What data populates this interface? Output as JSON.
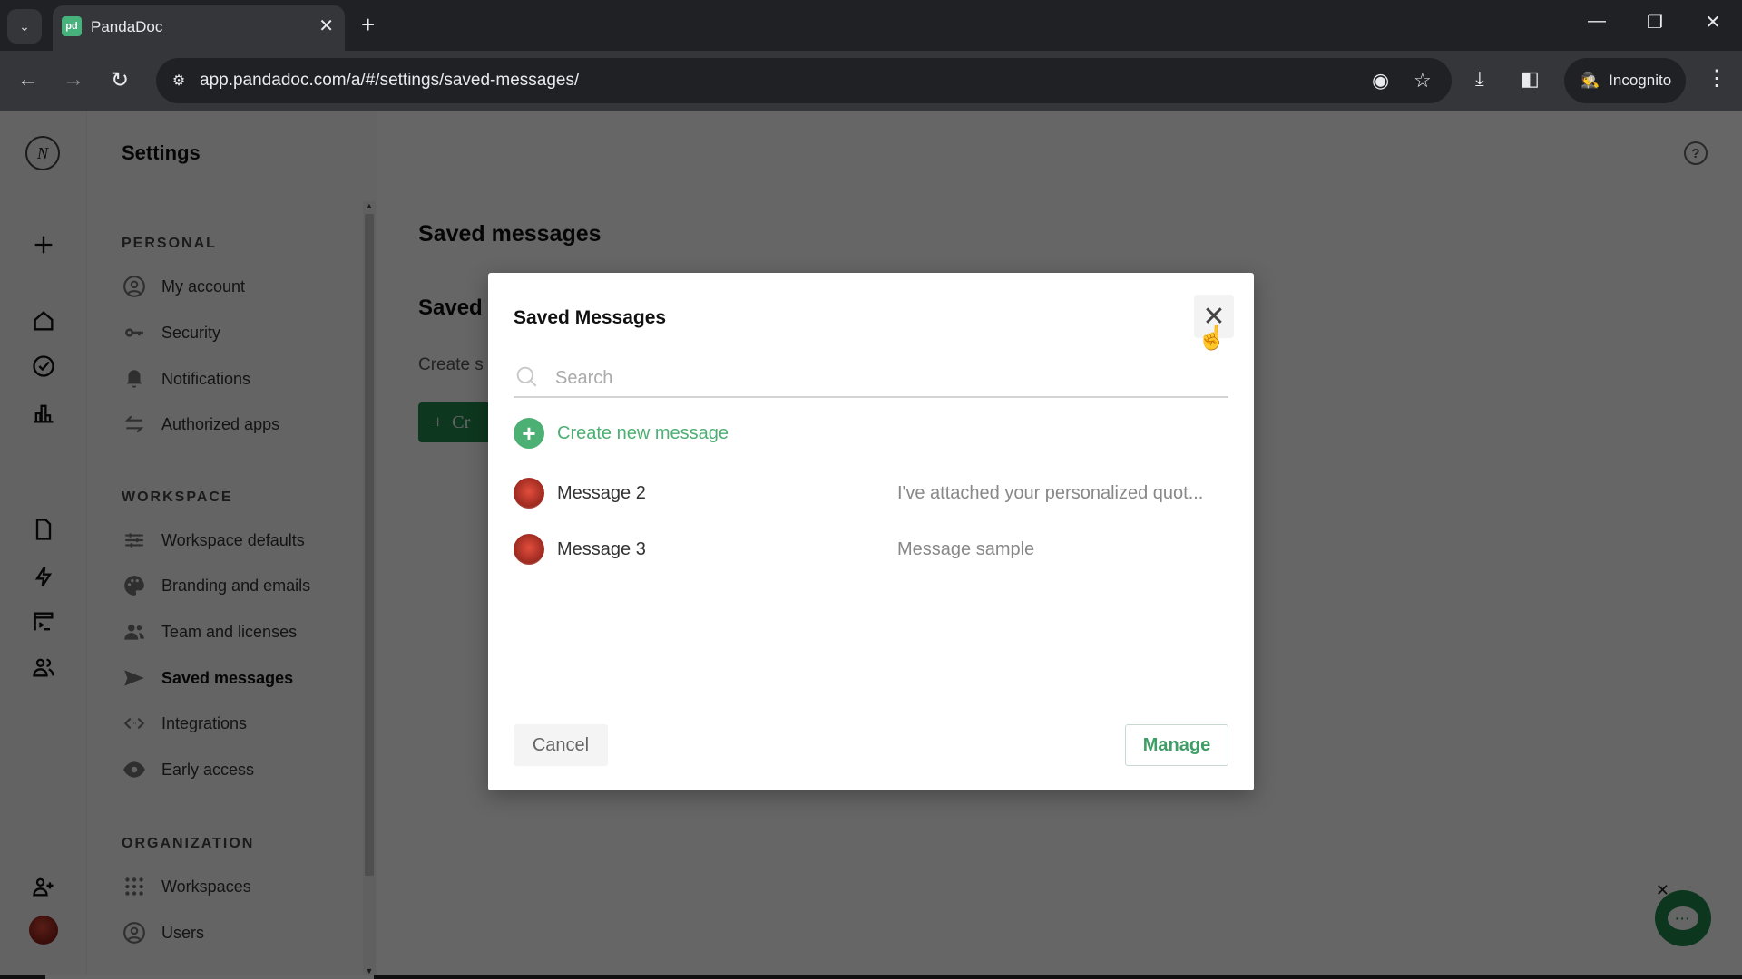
{
  "browser": {
    "tab_title": "PandaDoc",
    "favicon_text": "pd",
    "url": "app.pandadoc.com/a/#/settings/saved-messages/",
    "profile_label": "Incognito"
  },
  "rail": {
    "logo_text": "N"
  },
  "settings_nav": {
    "title": "Settings",
    "sections": [
      {
        "label": "PERSONAL",
        "items": [
          {
            "label": "My account",
            "icon": "account-icon"
          },
          {
            "label": "Security",
            "icon": "key-icon"
          },
          {
            "label": "Notifications",
            "icon": "bell-icon"
          },
          {
            "label": "Authorized apps",
            "icon": "swap-arrows-icon"
          }
        ]
      },
      {
        "label": "WORKSPACE",
        "items": [
          {
            "label": "Workspace defaults",
            "icon": "sliders-icon"
          },
          {
            "label": "Branding and emails",
            "icon": "palette-icon"
          },
          {
            "label": "Team and licenses",
            "icon": "team-icon"
          },
          {
            "label": "Saved messages",
            "icon": "send-icon",
            "active": true
          },
          {
            "label": "Integrations",
            "icon": "code-icon"
          },
          {
            "label": "Early access",
            "icon": "eye-icon"
          }
        ]
      },
      {
        "label": "ORGANIZATION",
        "items": [
          {
            "label": "Workspaces",
            "icon": "grid-icon"
          },
          {
            "label": "Users",
            "icon": "account-icon"
          }
        ]
      }
    ]
  },
  "content": {
    "page_title": "Saved messages",
    "section_title": "Saved",
    "description": "Create s",
    "create_button": "Cr"
  },
  "modal": {
    "title": "Saved Messages",
    "search_placeholder": "Search",
    "search_value": "",
    "create_new_label": "Create new message",
    "messages": [
      {
        "name": "Message 2",
        "preview": "I've attached your personalized quot..."
      },
      {
        "name": "Message 3",
        "preview": "Message sample"
      }
    ],
    "cancel_label": "Cancel",
    "manage_label": "Manage"
  },
  "colors": {
    "brand_green": "#248a4f",
    "accent_green": "#4caf73",
    "overlay": "rgba(0,0,0,0.6)"
  }
}
